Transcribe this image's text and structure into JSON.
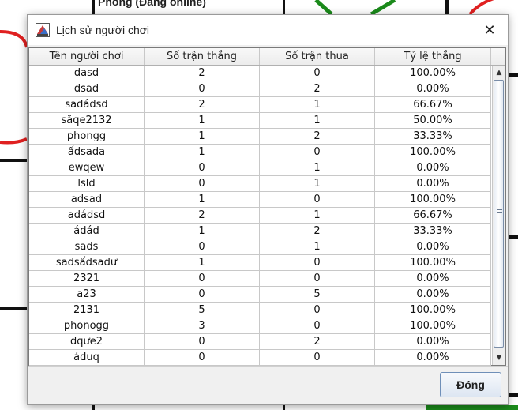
{
  "background": {
    "partial_title": "Phòng (Đang online)"
  },
  "dialog": {
    "title": "Lịch sử người chơi",
    "close_icon_glyph": "✕",
    "close_button_label": "Đóng"
  },
  "table": {
    "headers": [
      "Tên người chơi",
      "Số trận thắng",
      "Số trận thua",
      "Tỷ lệ thắng"
    ],
    "rows": [
      [
        "dasd",
        "2",
        "0",
        "100.00%"
      ],
      [
        "dsad",
        "0",
        "2",
        "0.00%"
      ],
      [
        "sadádsd",
        "2",
        "1",
        "66.67%"
      ],
      [
        "săqe2132",
        "1",
        "1",
        "50.00%"
      ],
      [
        "phongg",
        "1",
        "2",
        "33.33%"
      ],
      [
        "ấdsada",
        "1",
        "0",
        "100.00%"
      ],
      [
        "ewqew",
        "0",
        "1",
        "0.00%"
      ],
      [
        "lsld",
        "0",
        "1",
        "0.00%"
      ],
      [
        "adsad",
        "1",
        "0",
        "100.00%"
      ],
      [
        "adádsd",
        "2",
        "1",
        "66.67%"
      ],
      [
        "ádád",
        "1",
        "2",
        "33.33%"
      ],
      [
        "sads",
        "0",
        "1",
        "0.00%"
      ],
      [
        "sadsấdsadư",
        "1",
        "0",
        "100.00%"
      ],
      [
        "2321",
        "0",
        "0",
        "0.00%"
      ],
      [
        "a23",
        "0",
        "5",
        "0.00%"
      ],
      [
        "2131",
        "5",
        "0",
        "100.00%"
      ],
      [
        "phonogg",
        "3",
        "0",
        "100.00%"
      ],
      [
        "dqưe2",
        "0",
        "2",
        "0.00%"
      ],
      [
        "áduq",
        "0",
        "0",
        "0.00%"
      ]
    ]
  },
  "scrollbar": {
    "up_glyph": "▲",
    "down_glyph": "▼"
  }
}
